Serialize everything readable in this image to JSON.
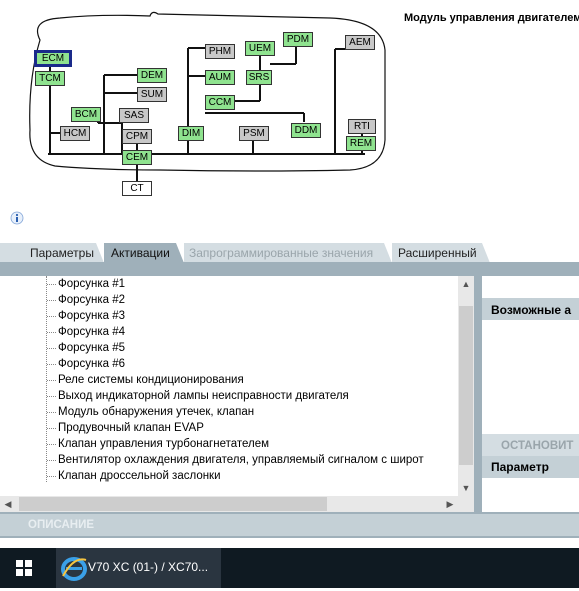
{
  "module_title": "Модуль управления двигателем",
  "network": {
    "nodes": [
      {
        "label": "ECM",
        "color": "green",
        "selected": true
      },
      {
        "label": "TCM",
        "color": "green"
      },
      {
        "label": "HCM",
        "color": "gray"
      },
      {
        "label": "BCM",
        "color": "green"
      },
      {
        "label": "SAS",
        "color": "gray"
      },
      {
        "label": "DEM",
        "color": "green"
      },
      {
        "label": "SUM",
        "color": "gray"
      },
      {
        "label": "CPM",
        "color": "gray"
      },
      {
        "label": "CEM",
        "color": "green"
      },
      {
        "label": "CT",
        "color": "white"
      },
      {
        "label": "PHM",
        "color": "gray"
      },
      {
        "label": "AUM",
        "color": "green"
      },
      {
        "label": "CCM",
        "color": "green"
      },
      {
        "label": "DIM",
        "color": "green"
      },
      {
        "label": "UEM",
        "color": "green"
      },
      {
        "label": "SRS",
        "color": "green"
      },
      {
        "label": "PDM",
        "color": "green"
      },
      {
        "label": "PSM",
        "color": "gray"
      },
      {
        "label": "DDM",
        "color": "green"
      },
      {
        "label": "AEM",
        "color": "gray"
      },
      {
        "label": "RTI",
        "color": "gray"
      },
      {
        "label": "REM",
        "color": "green"
      }
    ]
  },
  "tabs": [
    {
      "label": "Параметры",
      "state": "normal"
    },
    {
      "label": "Активации",
      "state": "active"
    },
    {
      "label": "Запрограммированные значения",
      "state": "disabled"
    },
    {
      "label": "Расширенный",
      "state": "normal"
    }
  ],
  "activations": [
    "Форсунка #1",
    "Форсунка #2",
    "Форсунка #3",
    "Форсунка #4",
    "Форсунка #5",
    "Форсунка #6",
    "Реле системы кондиционирования",
    "Выход индикаторной лампы неисправности двигателя",
    "Модуль обнаружения утечек, клапан",
    "Продувочный клапан EVAP",
    "Клапан управления турбонагнетателем",
    "Вентилятор охлаждения двигателя, управляемый сигналом с широт",
    "Клапан дроссельной заслонки"
  ],
  "right_panel": {
    "possible_header": "Возможные а",
    "stop_button": "ОСТАНОВИТ",
    "parameter_header": "Параметр"
  },
  "description_label": "ОПИСАНИЕ",
  "taskbar": {
    "app_label": "V70 XC (01-) / XC70..."
  },
  "colors": {
    "node_green": "#8fe38f",
    "node_gray": "#c8c8c8",
    "selected_border": "#1a2a8a",
    "panel_header": "#c4d0d6",
    "splitter": "#9fb0ba",
    "taskbar": "#0f1a22"
  },
  "icons": [
    "info-icon",
    "windows-start-icon",
    "internet-explorer-icon",
    "scroll-up-icon",
    "scroll-down-icon",
    "scroll-left-icon",
    "scroll-right-icon"
  ]
}
